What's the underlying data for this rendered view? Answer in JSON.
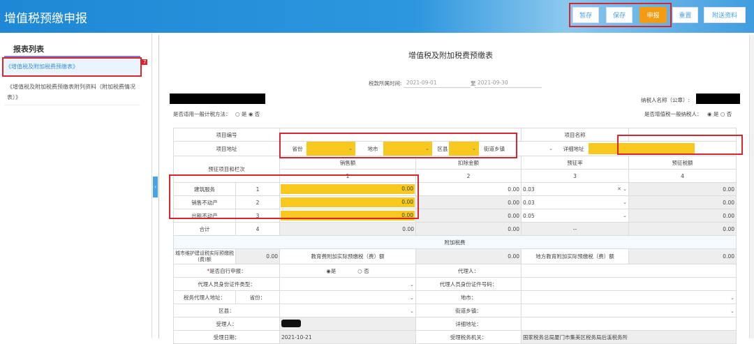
{
  "header": {
    "title": "增值税预缴申报",
    "buttons": [
      "暂存",
      "保存",
      "申报",
      "重置",
      "附送资料"
    ]
  },
  "sidebar": {
    "title": "报表列表",
    "items": [
      "《增值税及附加税费预缴表》",
      "《增值税及附加税费预缴表附列资料（附加税费情况表）》"
    ],
    "badge": "7"
  },
  "form": {
    "title": "增值税及附加税费预缴表",
    "period_label": "税款所属时间:",
    "period_from": "2021-09-01",
    "period_to_label": "至",
    "period_to": "2021-09-30",
    "taxpayer_label": "纳税人名称（公章）:",
    "general_method_label": "是否适用一般计税方法：",
    "yes": "是",
    "no": "否",
    "general_taxpayer_label": "是否增值税一般纳税人：",
    "project_no": "项目编号",
    "project_name": "项目名称",
    "project_addr": "项目地址",
    "province": "省份",
    "city": "地市",
    "district": "区县",
    "street": "街道乡镇",
    "detail_addr": "详细地址",
    "item_col": "预征项目和栏次",
    "cols": [
      "销售额",
      "扣除金额",
      "预征率",
      "预征税额"
    ],
    "col_nums": [
      "1",
      "2",
      "3",
      "4"
    ],
    "rows": [
      {
        "name": "建筑服务",
        "no": "1",
        "sales": "0.00",
        "deduct": "0.00",
        "rate": "0.03",
        "tax": "0.00"
      },
      {
        "name": "销售不动产",
        "no": "2",
        "sales": "0.00",
        "deduct": "0.00",
        "rate": "0.03",
        "tax": "0.00"
      },
      {
        "name": "出租不动产",
        "no": "3",
        "sales": "0.00",
        "deduct": "0.00",
        "rate": "0.05",
        "tax": "0.00"
      }
    ],
    "total": {
      "name": "合计",
      "no": "4",
      "sales": "0.00",
      "deduct": "0.00",
      "rate": "--",
      "tax": "0.00"
    },
    "surcharge_title": "附加税费",
    "urban_label": "城市维护建设税实际预缴税(费)额",
    "urban_val": "0.00",
    "edu_label": "教育费附加实际预缴税（费）额",
    "edu_val": "0.00",
    "local_edu_label": "地方教育附加实际预缴税（费）额",
    "local_edu_val": "0.00",
    "self_declare_label": "是否自行申报：",
    "agent_label": "代理人：",
    "agent_id_type_label": "代理人员身份证件类型：",
    "agent_id_no_label": "代理人员身份证件号码：",
    "agent_addr_label": "税务代理人地址：",
    "province2": "省份：",
    "city2": "地市：",
    "district2": "区县：",
    "street2": "街道乡镇：",
    "receiver_label": "受理人：",
    "detail_addr2": "详细地址：",
    "accept_date_label": "受理日期：",
    "accept_date": "2021-10-21",
    "tax_office_label": "受理税务机关：",
    "tax_office": "国家税务总局厦门市集美区税务局后溪税务所"
  },
  "colors": {
    "accent": "#2c96de",
    "highlight": "#f7c81d",
    "orange": "#f49b12",
    "red": "#d9252f"
  }
}
